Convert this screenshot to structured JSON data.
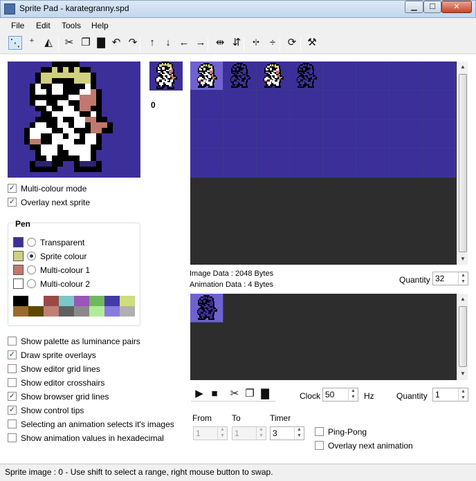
{
  "window": {
    "title": "Sprite Pad - karategranny.spd"
  },
  "menu": [
    "File",
    "Edit",
    "Tools",
    "Help"
  ],
  "toolbar": [
    {
      "name": "select-tool",
      "glyph": "⋱"
    },
    {
      "name": "pencil-tool",
      "glyph": "⁺"
    },
    {
      "name": "fill-tool",
      "glyph": "◭"
    },
    {
      "name": "cut-icon",
      "glyph": "✂"
    },
    {
      "name": "copy-icon",
      "glyph": "❐"
    },
    {
      "name": "paste-icon",
      "glyph": "▇"
    },
    {
      "name": "undo-icon",
      "glyph": "↶"
    },
    {
      "name": "redo-icon",
      "glyph": "↷"
    },
    {
      "name": "shift-up-icon",
      "glyph": "↑"
    },
    {
      "name": "shift-down-icon",
      "glyph": "↓"
    },
    {
      "name": "shift-left-icon",
      "glyph": "←"
    },
    {
      "name": "shift-right-icon",
      "glyph": "→"
    },
    {
      "name": "flip-horizontal-icon",
      "glyph": "⇹"
    },
    {
      "name": "flip-vertical-icon",
      "glyph": "⇵"
    },
    {
      "name": "reflect-horizontal-icon",
      "glyph": "•|•"
    },
    {
      "name": "reflect-vertical-icon",
      "glyph": "÷"
    },
    {
      "name": "rotate-icon",
      "glyph": "⟳"
    },
    {
      "name": "properties-icon",
      "glyph": "⚒"
    }
  ],
  "options": {
    "multicolour_mode": "Multi-colour mode",
    "overlay_next_sprite": "Overlay next sprite"
  },
  "pen": {
    "title": "Pen",
    "items": [
      {
        "label": "Transparent",
        "color": "#3c2f99",
        "selected": false
      },
      {
        "label": "Sprite colour",
        "color": "#d0d080",
        "selected": true
      },
      {
        "label": "Multi-colour 1",
        "color": "#c07870",
        "selected": false
      },
      {
        "label": "Multi-colour 2",
        "color": "#ffffff",
        "selected": false
      }
    ],
    "palette": [
      "#000000",
      "#ffffff",
      "#9a4a44",
      "#7ac8c8",
      "#9a55b8",
      "#70b860",
      "#443aa8",
      "#d0dc80",
      "#9a6a2a",
      "#5e4800",
      "#c08078",
      "#606060",
      "#8a8a8a",
      "#b0ec98",
      "#8a7ae0",
      "#b0b0b0"
    ]
  },
  "settings": [
    {
      "label": "Show palette as luminance pairs",
      "checked": false
    },
    {
      "label": "Draw sprite overlays",
      "checked": true
    },
    {
      "label": "Show editor grid lines",
      "checked": false
    },
    {
      "label": "Show editor crosshairs",
      "checked": false
    },
    {
      "label": "Show browser grid lines",
      "checked": true
    },
    {
      "label": "Show control tips",
      "checked": true
    },
    {
      "label": "Selecting an animation selects it's images",
      "checked": false
    },
    {
      "label": "Show animation values in hexadecimal",
      "checked": false
    }
  ],
  "sprite_number": "0",
  "info": {
    "image_data": "Image Data : 2048 Bytes",
    "animation_data": "Animation Data : 4 Bytes",
    "quantity_label": "Quantity",
    "quantity_value": "32"
  },
  "anim": {
    "clock_label": "Clock",
    "clock_value": "50",
    "clock_unit": "Hz",
    "quantity_label": "Quantity",
    "quantity_value": "1",
    "from_label": "From",
    "to_label": "To",
    "timer_label": "Timer",
    "from_value": "1",
    "to_value": "1",
    "timer_value": "3",
    "ping_pong": "Ping-Pong",
    "overlay_next_animation": "Overlay next animation"
  },
  "status": "Sprite image : 0 - Use shift to select a range, right mouse button to swap.",
  "colors": {
    "sprite_bg": "#3c2f99",
    "empty_bg": "#2d2d2d",
    "selected_cell": "#6f62d0"
  }
}
